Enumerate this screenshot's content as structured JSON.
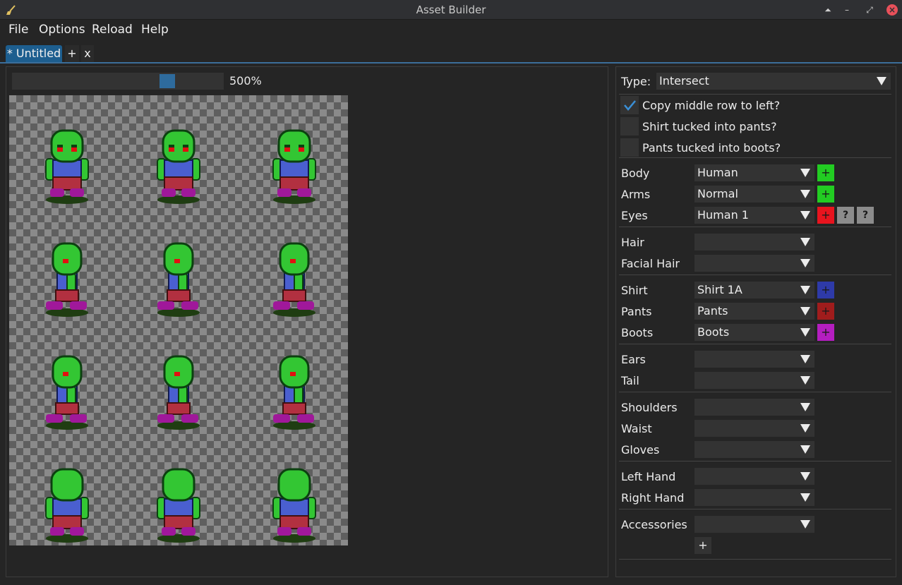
{
  "window": {
    "title": "Asset Builder"
  },
  "menu": [
    "File",
    "Options",
    "Reload",
    "Help"
  ],
  "tabs": {
    "active": "* Untitled",
    "add": "+",
    "close": "x"
  },
  "zoom": {
    "label": "500%",
    "slider_fraction": 0.75
  },
  "panel": {
    "type_label": "Type:",
    "type_value": "Intersect",
    "checks": [
      {
        "label": "Copy middle row to left?",
        "checked": true
      },
      {
        "label": "Shirt tucked into pants?",
        "checked": false
      },
      {
        "label": "Pants tucked into boots?",
        "checked": false
      }
    ],
    "rows": [
      {
        "label": "Body",
        "value": "Human",
        "color": "#22cc22",
        "btn": "+"
      },
      {
        "label": "Arms",
        "value": "Normal",
        "color": "#22cc22",
        "btn": "+"
      },
      {
        "label": "Eyes",
        "value": "Human 1",
        "color": "#e8141e",
        "btn": "+",
        "extra": [
          "?",
          "?"
        ]
      },
      {
        "label": "Hair",
        "value": ""
      },
      {
        "label": "Facial Hair",
        "value": ""
      },
      {
        "label": "Shirt",
        "value": "Shirt 1A",
        "color": "#2e3aa8",
        "btn": "+"
      },
      {
        "label": "Pants",
        "value": "Pants",
        "color": "#a01c1c",
        "btn": "+"
      },
      {
        "label": "Boots",
        "value": "Boots",
        "color": "#b41ec0",
        "btn": "+"
      },
      {
        "label": "Ears",
        "value": ""
      },
      {
        "label": "Tail",
        "value": ""
      },
      {
        "label": "Shoulders",
        "value": ""
      },
      {
        "label": "Waist",
        "value": ""
      },
      {
        "label": "Gloves",
        "value": ""
      },
      {
        "label": "Left Hand",
        "value": ""
      },
      {
        "label": "Right Hand",
        "value": ""
      },
      {
        "label": "Accessories",
        "value": ""
      }
    ],
    "add_accessory": "+"
  },
  "colors": {
    "accent": "#1d5e8f",
    "skin": "#33c633",
    "shirt": "#4a5fd0",
    "pants": "#b23040",
    "boots": "#a0189a"
  }
}
